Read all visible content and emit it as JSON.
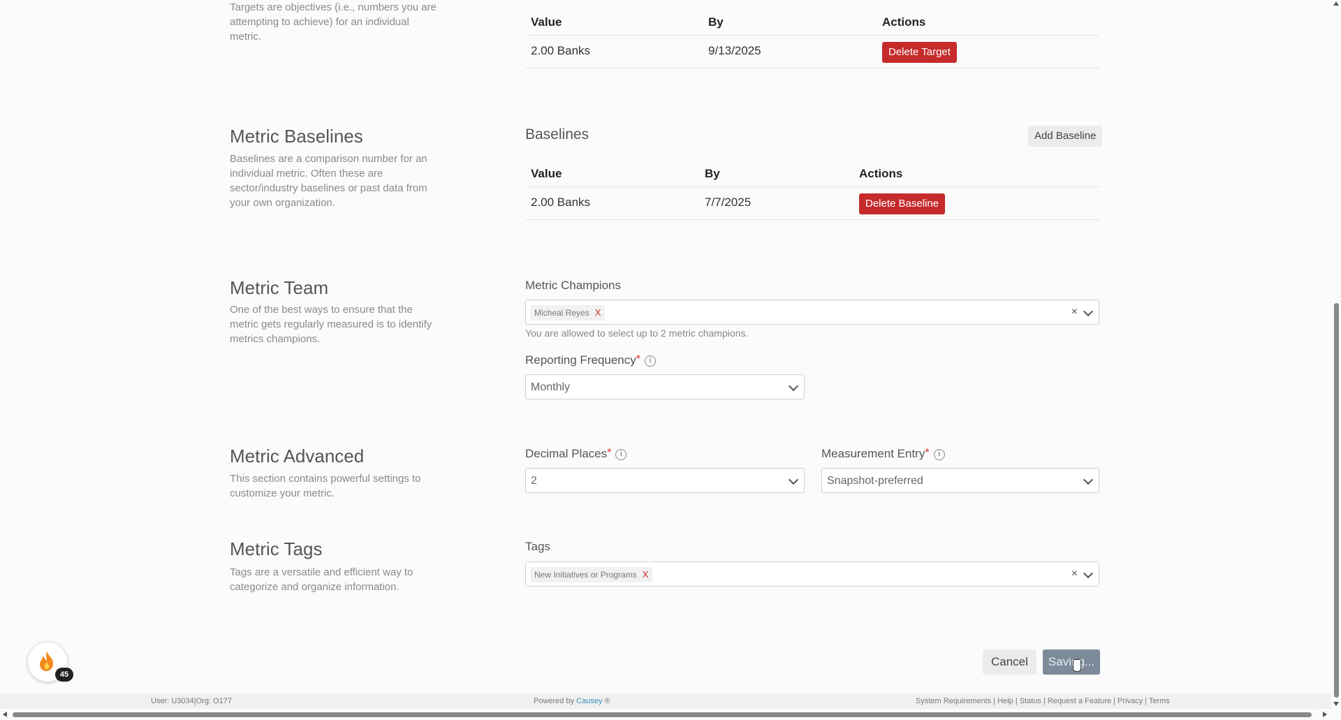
{
  "targets": {
    "desc": "Targets are objectives (i.e., numbers you are attempting to achieve) for an individual metric.",
    "columns": [
      "Value",
      "By",
      "Actions"
    ],
    "rows": [
      {
        "value": "2.00 Banks",
        "by": "9/13/2025",
        "action": "Delete Target"
      }
    ]
  },
  "baselines": {
    "title": "Metric Baselines",
    "desc": "Baselines are a comparison number for an individual metric. Often these are sector/industry baselines or past data from your own organization.",
    "panel_title": "Baselines",
    "add_label": "Add Baseline",
    "columns": [
      "Value",
      "By",
      "Actions"
    ],
    "rows": [
      {
        "value": "2.00 Banks",
        "by": "7/7/2025",
        "action": "Delete Baseline"
      }
    ]
  },
  "team": {
    "title": "Metric Team",
    "desc": "One of the best ways to ensure that the metric gets regularly measured is to identify metrics champions.",
    "champions_label": "Metric Champions",
    "champion_chip": "Micheal Reyes",
    "chip_remove": "X",
    "clear": "×",
    "champions_hint": "You are allowed to select up to 2 metric champions.",
    "frequency_label": "Reporting Frequency",
    "frequency_value": "Monthly",
    "required": "*",
    "info": "i"
  },
  "advanced": {
    "title": "Metric Advanced",
    "desc": "This section contains powerful settings to customize your metric.",
    "decimal_label": "Decimal Places",
    "decimal_value": "2",
    "entry_label": "Measurement Entry",
    "entry_value": "Snapshot-preferred"
  },
  "tags": {
    "title": "Metric Tags",
    "desc": "Tags are a versatile and efficient way to categorize and organize information.",
    "label": "Tags",
    "chip": "New Initiatives or Programs"
  },
  "actions": {
    "cancel": "Cancel",
    "saving": "Saving..."
  },
  "badge": {
    "count": "45"
  },
  "footer": {
    "user": "User: U3034|Org: O177",
    "powered_prefix": "Powered by",
    "powered_brand": "Causey",
    "powered_suffix": "®",
    "links": "System Requirements | Help | Status | Request a Feature | Privacy | Terms"
  },
  "colors": {
    "danger": "#c62a2a",
    "brand_link": "#3a8fb7",
    "save_button": "#7c8a99"
  }
}
